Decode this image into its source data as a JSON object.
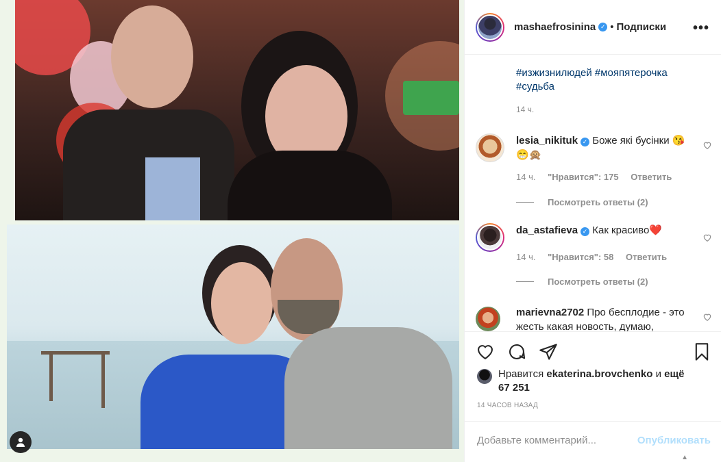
{
  "header": {
    "username": "mashaefrosinina",
    "separator": "•",
    "follow_label": "Подписки",
    "more_icon": "more-horizontal-icon"
  },
  "caption": {
    "hashtags": "#изжизнилюдей #мояпятерочка #судьба",
    "time": "14 ч."
  },
  "comments": [
    {
      "username": "lesia_nikituk",
      "text": "Боже які бусінки 😘😁🙊",
      "time": "14 ч.",
      "likes": "\"Нравится\": 175",
      "reply": "Ответить",
      "view_replies": "Посмотреть ответы (2)"
    },
    {
      "username": "da_astafieva",
      "text": "Как красиво❤️",
      "time": "14 ч.",
      "likes": "\"Нравится\": 58",
      "reply": "Ответить",
      "view_replies": "Посмотреть ответы (2)"
    },
    {
      "username": "marievna2702",
      "text": "Про бесплодие - это жесть какая новость, думаю,"
    }
  ],
  "likes": {
    "prefix": "Нравится",
    "user": "ekaterina.brovchenko",
    "conj": "и",
    "count": "ещё 67 251"
  },
  "posted": "14 ЧАСОВ НАЗАД",
  "add_comment": {
    "placeholder": "Добавьте комментарий...",
    "publish": "Опубликовать"
  },
  "colors": {
    "link": "#00376b",
    "verified": "#3897f0",
    "muted": "#8e8e8e",
    "publish_disabled": "#b2dffc"
  }
}
